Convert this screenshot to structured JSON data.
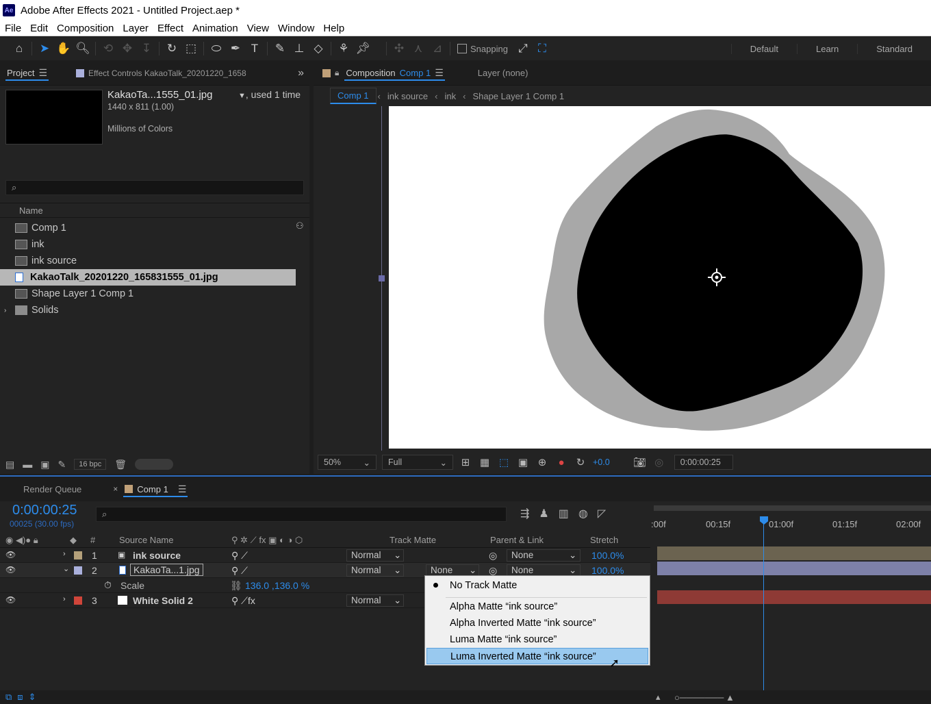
{
  "window": {
    "title": "Adobe After Effects 2021 - Untitled Project.aep *",
    "app_icon": "Ae"
  },
  "menu": [
    "File",
    "Edit",
    "Composition",
    "Layer",
    "Effect",
    "Animation",
    "View",
    "Window",
    "Help"
  ],
  "toolbar": {
    "snapping_label": "Snapping",
    "workspaces": [
      "Default",
      "Learn",
      "Standard"
    ]
  },
  "project_panel": {
    "tabs": {
      "project": "Project",
      "effect_controls": "Effect Controls KakaoTalk_20201220_1658"
    },
    "selected_item": {
      "name": "KakaoTa...1555_01.jpg",
      "usage": ", used 1 time",
      "dimensions": "1440 x 811 (1.00)",
      "colors": "Millions of Colors"
    },
    "search_placeholder": "⌕",
    "column_name": "Name",
    "items": [
      {
        "name": "Comp 1",
        "type": "comp"
      },
      {
        "name": "ink",
        "type": "comp"
      },
      {
        "name": "ink source",
        "type": "comp"
      },
      {
        "name": "KakaoTalk_20201220_165831555_01.jpg",
        "type": "image"
      },
      {
        "name": "Shape Layer 1 Comp 1",
        "type": "comp"
      },
      {
        "name": "Solids",
        "type": "folder"
      }
    ],
    "bpc": "16 bpc"
  },
  "composition_panel": {
    "tab_prefix": "Composition",
    "tab_comp": "Comp 1",
    "layer_tab": "Layer (none)",
    "breadcrumbs": [
      "Comp 1",
      "ink source",
      "ink",
      "Shape Layer 1 Comp 1"
    ],
    "zoom": "50%",
    "resolution": "Full",
    "exposure": "+0.0",
    "timecode": "0:00:00:25"
  },
  "timeline": {
    "tabs": {
      "render_queue": "Render Queue",
      "comp": "Comp 1"
    },
    "current_time": "0:00:00:25",
    "fps": "00025 (30.00 fps)",
    "columns": {
      "hash": "#",
      "source_name": "Source Name",
      "track_matte": "Track Matte",
      "parent_link": "Parent & Link",
      "stretch": "Stretch"
    },
    "ruler": [
      ":00f",
      "00:15f",
      "01:00f",
      "01:15f",
      "02:00f"
    ],
    "layers": [
      {
        "num": "1",
        "name": "ink source",
        "mode": "Normal",
        "parent": "None",
        "stretch": "100.0%",
        "label_color": "#b4a07a"
      },
      {
        "num": "2",
        "name": "KakaoTa...1.jpg",
        "mode": "Normal",
        "track_matte": "None",
        "parent": "None",
        "stretch": "100.0%",
        "label_color": "#aab0dc"
      },
      {
        "num": "3",
        "name": "White Solid 2",
        "mode": "Normal",
        "label_color": "#d0453a"
      }
    ],
    "scale_property": {
      "label": "Scale",
      "value": "136.0 ,136.0 %"
    }
  },
  "track_matte_menu": {
    "items": [
      "No Track Matte",
      "Alpha Matte “ink source”",
      "Alpha Inverted Matte “ink source”",
      "Luma Matte “ink source”",
      "Luma Inverted Matte “ink source”"
    ],
    "selected_index": 0,
    "highlighted_index": 4
  },
  "colors": {
    "accent": "#2d8ceb",
    "panel": "#232323"
  }
}
